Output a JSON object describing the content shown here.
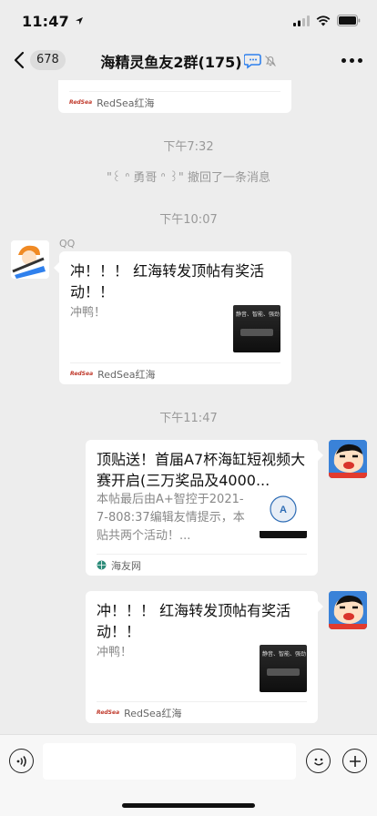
{
  "status_bar": {
    "time": "11:47"
  },
  "nav": {
    "unread_count": "678",
    "title": "海精灵鱼友2群(175)"
  },
  "messages": {
    "top_card": {
      "source": "RedSea红海"
    },
    "ts1": "下午7:32",
    "recall": {
      "name": "\"꒰ ᐢ 勇哥 ᐢ ꒱\"",
      "text": "撤回了一条消息"
    },
    "ts2": "下午10:07",
    "qq_sender": "QQ",
    "card1": {
      "title": "冲！！！ 红海转发顶帖有奖活动！！",
      "desc": "冲鸭！",
      "source": "RedSea红海",
      "thumb_text": "静音、智能、强劲"
    },
    "ts3": "下午11:47",
    "card2": {
      "title": "顶贴送！首届A7杯海缸短视频大赛开启(三万奖品及4000...",
      "desc": "本帖最后由A+智控于2021-7-808:37编辑友情提示，本贴共两个活动！...",
      "source": "海友网"
    },
    "card3": {
      "title": "冲！！！ 红海转发顶帖有奖活动！！",
      "desc": "冲鸭！",
      "source": "RedSea红海",
      "thumb_text": "静音、智能、强劲"
    }
  },
  "input": {
    "placeholder": ""
  },
  "rs_logo": "RedSea"
}
